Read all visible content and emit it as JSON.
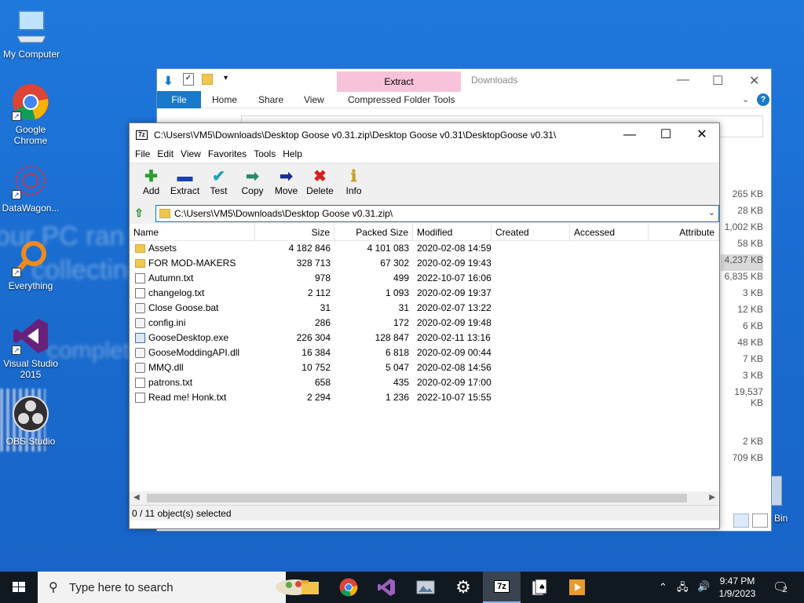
{
  "desktop": {
    "icons": [
      {
        "label": "My Computer"
      },
      {
        "label": "Google Chrome"
      },
      {
        "label": "DataWagon..."
      },
      {
        "label": "Everything"
      },
      {
        "label": "Visual Studio 2015"
      },
      {
        "label": "OBS Studio"
      }
    ],
    "wallpaper_text": [
      "our PC ran into",
      "collecting s",
      "complete"
    ],
    "recycle_bin_fragment": "Bin"
  },
  "explorer": {
    "title": "Downloads",
    "context_tab": "Extract",
    "tabs": [
      "File",
      "Home",
      "Share",
      "View",
      "Compressed Folder Tools"
    ],
    "sizes": [
      "265 KB",
      "28 KB",
      "1,002 KB",
      "58 KB",
      "4,237 KB",
      "6,835 KB",
      "3 KB",
      "12 KB",
      "6 KB",
      "48 KB",
      "7 KB",
      "3 KB",
      "19,537 KB",
      "",
      "",
      "2 KB",
      "709 KB"
    ],
    "highlighted_size_index": 4
  },
  "sevenzip": {
    "title": "C:\\Users\\VM5\\Downloads\\Desktop Goose v0.31.zip\\Desktop Goose v0.31\\DesktopGoose v0.31\\",
    "app_icon": "7z",
    "menu": [
      "File",
      "Edit",
      "View",
      "Favorites",
      "Tools",
      "Help"
    ],
    "toolbar": [
      {
        "label": "Add",
        "icon": "plus-icon",
        "glyph": "✚",
        "color": "#2aa02a"
      },
      {
        "label": "Extract",
        "icon": "minus-icon",
        "glyph": "▬",
        "color": "#1a3fb0"
      },
      {
        "label": "Test",
        "icon": "check-icon",
        "glyph": "✔",
        "color": "#19a3b8"
      },
      {
        "label": "Copy",
        "icon": "double-arrow-icon",
        "glyph": "➡",
        "color": "#2a8a6a"
      },
      {
        "label": "Move",
        "icon": "arrow-right-icon",
        "glyph": "➡",
        "color": "#1a2a90"
      },
      {
        "label": "Delete",
        "icon": "x-icon",
        "glyph": "✖",
        "color": "#d62020"
      },
      {
        "label": "Info",
        "icon": "info-icon",
        "glyph": "ℹ",
        "color": "#c8a020"
      }
    ],
    "address": "C:\\Users\\VM5\\Downloads\\Desktop Goose v0.31.zip\\",
    "columns": [
      "Name",
      "Size",
      "Packed Size",
      "Modified",
      "Created",
      "Accessed",
      "Attribute"
    ],
    "files": [
      {
        "name": "Assets",
        "type": "folder",
        "size": "4 182 846",
        "packed": "4 101 083",
        "modified": "2020-02-08 14:59"
      },
      {
        "name": "FOR MOD-MAKERS",
        "type": "folder",
        "size": "328 713",
        "packed": "67 302",
        "modified": "2020-02-09 19:43"
      },
      {
        "name": "Autumn.txt",
        "type": "doc",
        "size": "978",
        "packed": "499",
        "modified": "2022-10-07 16:06"
      },
      {
        "name": "changelog.txt",
        "type": "doc",
        "size": "2 112",
        "packed": "1 093",
        "modified": "2020-02-09 19:37"
      },
      {
        "name": "Close Goose.bat",
        "type": "gear",
        "size": "31",
        "packed": "31",
        "modified": "2020-02-07 13:22"
      },
      {
        "name": "config.ini",
        "type": "gear",
        "size": "286",
        "packed": "172",
        "modified": "2020-02-09 19:48"
      },
      {
        "name": "GooseDesktop.exe",
        "type": "exe",
        "size": "226 304",
        "packed": "128 847",
        "modified": "2020-02-11 13:16"
      },
      {
        "name": "GooseModdingAPI.dll",
        "type": "gear",
        "size": "16 384",
        "packed": "6 818",
        "modified": "2020-02-09 00:44"
      },
      {
        "name": "MMQ.dll",
        "type": "gear",
        "size": "10 752",
        "packed": "5 047",
        "modified": "2020-02-08 14:56"
      },
      {
        "name": "patrons.txt",
        "type": "doc",
        "size": "658",
        "packed": "435",
        "modified": "2020-02-09 17:00"
      },
      {
        "name": "Read me! Honk.txt",
        "type": "doc",
        "size": "2 294",
        "packed": "1 236",
        "modified": "2022-10-07 15:55"
      }
    ],
    "status": "0 / 11 object(s) selected"
  },
  "taskbar": {
    "search_placeholder": "Type here to search",
    "apps": [
      "file-explorer-icon",
      "chrome-icon",
      "visual-studio-icon",
      "photos-icon",
      "settings-icon",
      "7zip-icon",
      "solitaire-icon",
      "media-player-icon"
    ],
    "time": "9:47 PM",
    "date": "1/9/2023",
    "notifications": "2"
  }
}
